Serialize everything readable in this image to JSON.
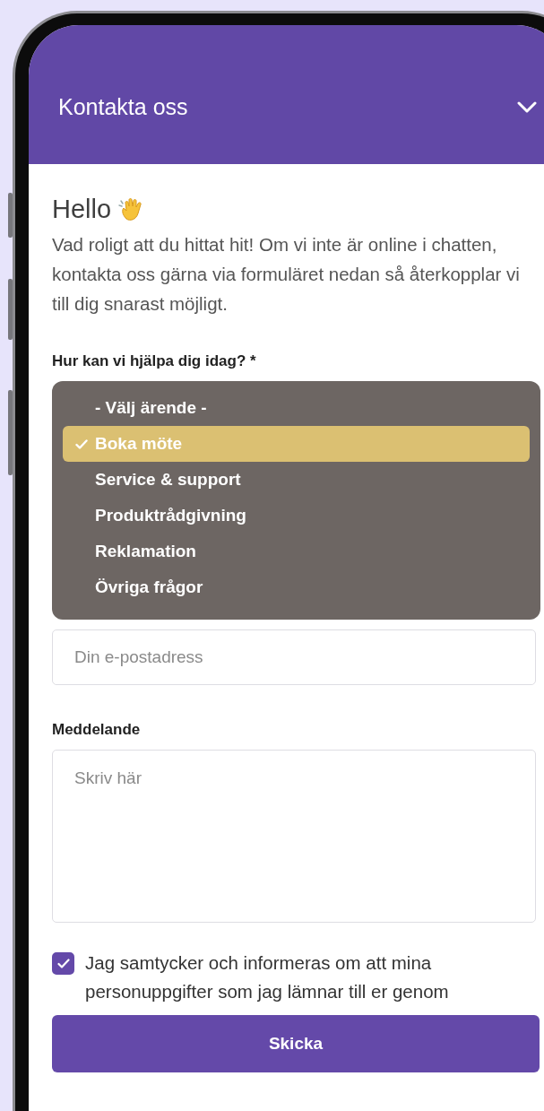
{
  "header": {
    "title": "Kontakta oss"
  },
  "greeting": {
    "title": "Hello",
    "text": "Vad roligt att du hittat hit! Om vi inte är online i chatten, kontakta oss gärna via formuläret nedan så återkopplar vi till dig snarast möjligt."
  },
  "topic": {
    "label": "Hur kan vi hjälpa dig idag? *",
    "options": [
      {
        "label": "- Välj ärende -",
        "selected": false
      },
      {
        "label": "Boka möte",
        "selected": true
      },
      {
        "label": "Service & support",
        "selected": false
      },
      {
        "label": "Produktrådgivning",
        "selected": false
      },
      {
        "label": "Reklamation",
        "selected": false
      },
      {
        "label": "Övriga frågor",
        "selected": false
      }
    ]
  },
  "email": {
    "placeholder": "Din e-postadress"
  },
  "message": {
    "label": "Meddelande",
    "placeholder": "Skriv här"
  },
  "consent": {
    "checked": true,
    "text": "Jag samtycker och informeras om att mina personuppgifter som jag lämnar till er genom"
  },
  "submit": {
    "label": "Skicka"
  }
}
